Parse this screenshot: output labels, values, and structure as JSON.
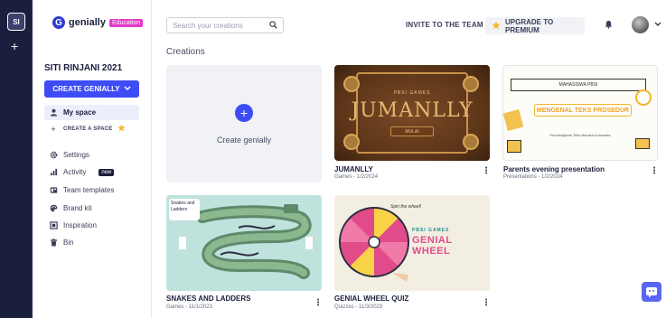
{
  "rail": {
    "workspace_initials": "SI"
  },
  "brand": {
    "name": "genially",
    "badge": "Education"
  },
  "sidebar": {
    "workspace_name": "SITI RINJANI 2021",
    "create_button": "CREATE GENIALLY",
    "my_space": "My space",
    "create_space": "CREATE A SPACE",
    "items": [
      {
        "label": "Settings",
        "icon": "gear-icon"
      },
      {
        "label": "Activity",
        "icon": "chart-icon",
        "badge": "new"
      },
      {
        "label": "Team templates",
        "icon": "template-icon"
      },
      {
        "label": "Brand kit",
        "icon": "palette-icon"
      },
      {
        "label": "Inspiration",
        "icon": "inspiration-icon"
      },
      {
        "label": "Bin",
        "icon": "trash-icon"
      }
    ]
  },
  "topbar": {
    "search_placeholder": "Search your creations",
    "invite": "INVITE TO THE TEAM",
    "upgrade": "UPGRADE TO PREMIUM"
  },
  "main": {
    "section_title": "Creations",
    "create_label": "Create genially",
    "cards": [
      {
        "title": "JUMANLLY",
        "meta": "Games - 1/2/2024",
        "thumb_small": "PBSI GAMES",
        "thumb_big": "JUMANLLY",
        "thumb_button": "MULAI"
      },
      {
        "title": "Parents evening presentation",
        "meta": "Presentations - 1/2/2024",
        "thumb_header": "MAHASISWA PBSI",
        "thumb_title": "MENGENAL TEKS PROSEDUR",
        "thumb_tiny": "Pembelajaran Teks Bahasa Indonesia"
      },
      {
        "title": "SNAKES AND LADDERS",
        "meta": "Games - 11/1/2023",
        "thumb_label": "Snakes and Ladders"
      },
      {
        "title": "GENIAL WHEEL QUIZ",
        "meta": "Quizzes - 11/3/2023",
        "thumb_small": "PBSI GAMES",
        "thumb_big": "GENIAL WHEEL",
        "thumb_spin": "Spin the wheel!"
      }
    ]
  },
  "colors": {
    "rail": "#1a1f3d",
    "primary": "#3e4cf5",
    "education_badge": "#e33ac8",
    "star": "#f5b82e"
  }
}
